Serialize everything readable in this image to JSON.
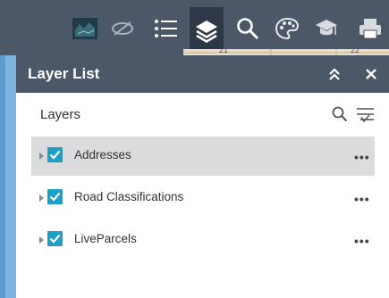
{
  "toolbar": {
    "buttons": [
      {
        "name": "basemap-thumbnail",
        "icon": "basemap-icon"
      },
      {
        "name": "visibility",
        "icon": "eye-slash-icon"
      },
      {
        "name": "legend",
        "icon": "list-icon"
      },
      {
        "name": "layer-list",
        "icon": "layers-icon",
        "active": true
      },
      {
        "name": "search",
        "icon": "search-icon"
      },
      {
        "name": "basemap-gallery",
        "icon": "palette-icon"
      },
      {
        "name": "about",
        "icon": "graduation-cap-icon"
      },
      {
        "name": "print",
        "icon": "printer-icon"
      }
    ]
  },
  "map_labels": [
    "21",
    "22"
  ],
  "panel": {
    "title": "Layer List",
    "collapse_icon": "double-chevron-up-icon",
    "close_icon": "close-icon",
    "layers_heading": "Layers",
    "layers": [
      {
        "label": "Addresses",
        "checked": true,
        "highlighted": true
      },
      {
        "label": "Road Classifications",
        "checked": true,
        "highlighted": false
      },
      {
        "label": "LiveParcels",
        "checked": true,
        "highlighted": false
      }
    ],
    "more_label": "•••"
  },
  "colors": {
    "header_bg": "#4c5768",
    "active_tool_bg": "#2f3846",
    "checkbox": "#1e9fc7",
    "row_highlight": "#dadcde"
  }
}
